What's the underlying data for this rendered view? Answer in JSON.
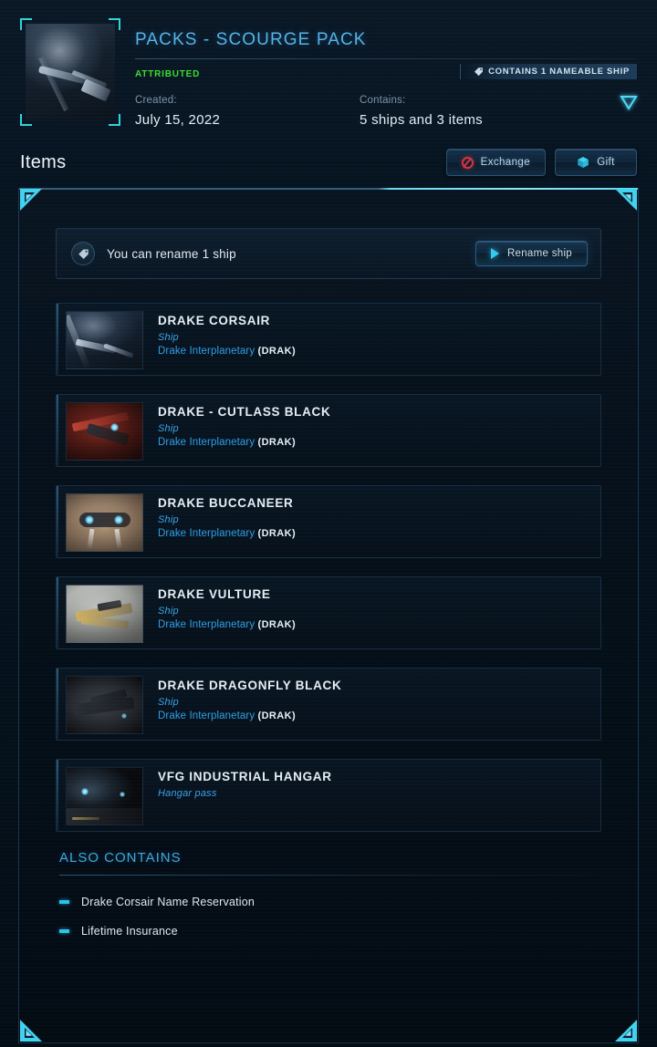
{
  "header": {
    "title": "PACKS - SCOURGE PACK",
    "status": "ATTRIBUTED",
    "nameable_badge": "CONTAINS 1 NAMEABLE SHIP",
    "created_label": "Created:",
    "created_value": "July 15, 2022",
    "contains_label": "Contains:",
    "contains_value": "5 ships and 3 items",
    "thumbnail_alt": "scourge-pack-art",
    "accent_color": "#52b4e8",
    "status_color": "#3ddc2e"
  },
  "items_bar": {
    "title": "Items",
    "exchange_label": "Exchange",
    "gift_label": "Gift"
  },
  "notice": {
    "text": "You can rename 1 ship",
    "button_label": "Rename ship"
  },
  "items": [
    {
      "name": "DRAKE CORSAIR",
      "type": "Ship",
      "manufacturer": "Drake Interplanetary",
      "manufacturer_code": "(DRAK)",
      "art": "art-corsair"
    },
    {
      "name": "DRAKE - CUTLASS BLACK",
      "type": "Ship",
      "manufacturer": "Drake Interplanetary",
      "manufacturer_code": "(DRAK)",
      "art": "art-cutlass"
    },
    {
      "name": "DRAKE BUCCANEER",
      "type": "Ship",
      "manufacturer": "Drake Interplanetary",
      "manufacturer_code": "(DRAK)",
      "art": "art-buccaneer"
    },
    {
      "name": "DRAKE VULTURE",
      "type": "Ship",
      "manufacturer": "Drake Interplanetary",
      "manufacturer_code": "(DRAK)",
      "art": "art-vulture"
    },
    {
      "name": "DRAKE DRAGONFLY BLACK",
      "type": "Ship",
      "manufacturer": "Drake Interplanetary",
      "manufacturer_code": "(DRAK)",
      "art": "art-dragonfly"
    },
    {
      "name": "VFG INDUSTRIAL HANGAR",
      "type": "Hangar pass",
      "manufacturer": "",
      "manufacturer_code": "",
      "art": "art-hangar"
    }
  ],
  "also_contains": {
    "title": "ALSO CONTAINS",
    "items": [
      "Drake Corsair Name Reservation",
      "Lifetime Insurance"
    ]
  },
  "icons": {
    "tag": "tag-icon",
    "exchange": "exchange-icon",
    "gift": "gift-icon",
    "play": "play-icon",
    "expander": "chevron-down-triangle-icon"
  }
}
